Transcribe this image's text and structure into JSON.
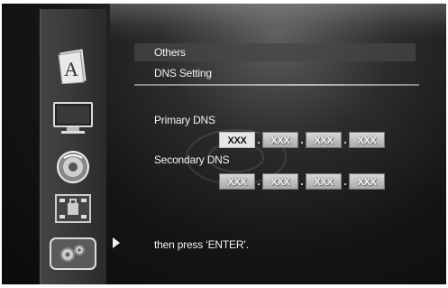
{
  "breadcrumbs": [
    "Others",
    "DNS Setting"
  ],
  "primary_dns": {
    "label": "Primary DNS",
    "octets": [
      "XXX",
      "XXX",
      "XXX",
      "XXX"
    ],
    "separator": "."
  },
  "secondary_dns": {
    "label": "Secondary DNS",
    "octets": [
      "XXX",
      "XXX",
      "XXX",
      "XXX"
    ],
    "separator": "."
  },
  "hint": "then press ‘ENTER’.",
  "sidebar": {
    "items": [
      {
        "icon": "language-icon"
      },
      {
        "icon": "display-icon"
      },
      {
        "icon": "audio-icon"
      },
      {
        "icon": "parental-icon"
      },
      {
        "icon": "network-icon"
      }
    ],
    "selected_index": 4
  },
  "colors": {
    "background": "#151515",
    "sidebar": "#3a3a3a",
    "text": "#f0f0f0",
    "active_field": "#e6e6e6",
    "inactive_field": "#b5b5b5"
  }
}
